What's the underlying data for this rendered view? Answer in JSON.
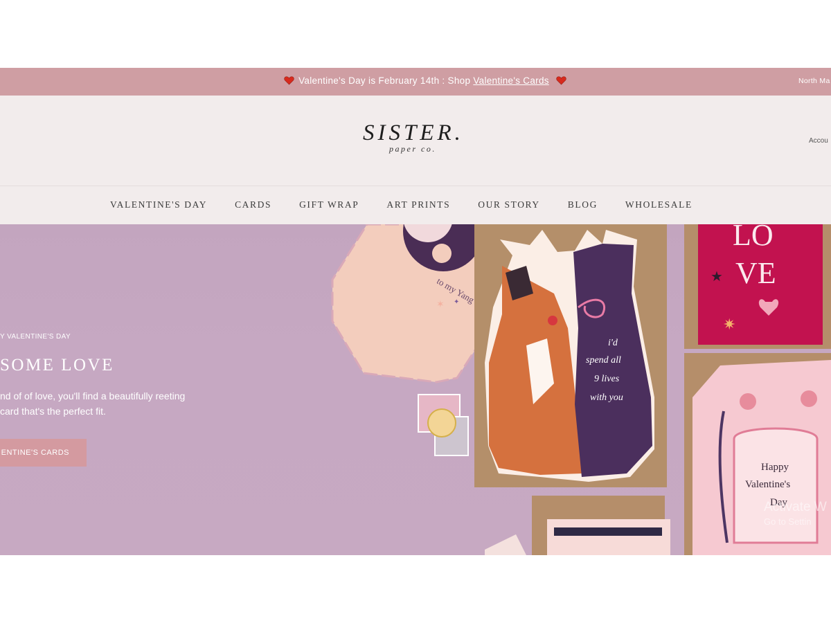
{
  "announcement": {
    "prefix": "Valentine's Day is February 14th : Shop ",
    "link": "Valentine's Cards",
    "region": "North Ma"
  },
  "header": {
    "logo_main": "SISTER.",
    "logo_sub": "paper co.",
    "account": "Accou"
  },
  "nav": {
    "items": [
      "VALENTINE'S DAY",
      "CARDS",
      "GIFT WRAP",
      "ART PRINTS",
      "OUR STORY",
      "BLOG",
      "WHOLESALE"
    ]
  },
  "hero": {
    "eyebrow": "Y VALENTINE'S DAY",
    "title": "SOME LOVE",
    "body": "nd of of love, you'll find a beautifully reeting card that's the perfect fit.",
    "cta": "ENTINE'S CARDS",
    "cards": {
      "yang_text": "to my Yang",
      "cat_line1": "i'd",
      "cat_line2": "spend all",
      "cat_line3": "9 lives",
      "cat_line4": "with you",
      "love_line1": "LO",
      "love_line2": "VE",
      "happy_line1": "Happy",
      "happy_line2": "Valentine's",
      "happy_line3": "Day"
    },
    "watermark_line1": "Activate W",
    "watermark_line2": "Go to Settin"
  },
  "colors": {
    "announce_bg": "#cf9ea3",
    "header_bg": "#f2ecec",
    "hero_bg": "#c6a8c2",
    "cta_bg": "#d49aa0"
  }
}
